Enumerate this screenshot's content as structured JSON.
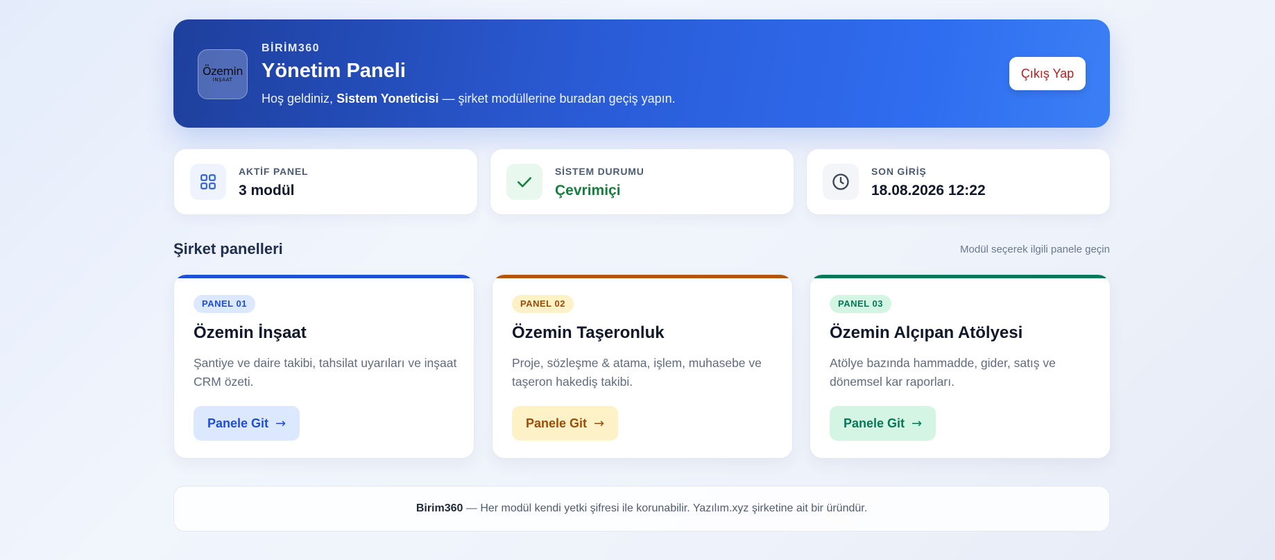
{
  "header": {
    "logo_line1": "Özemin",
    "logo_line2": "İNŞAAT",
    "brand": "BİRİM360",
    "title": "Yönetim Paneli",
    "welcome_prefix": "Hoş geldiniz, ",
    "user_name": "Sistem Yoneticisi",
    "welcome_suffix": " — şirket modüllerine buradan geçiş yapın.",
    "logout_label": "Çıkış Yap"
  },
  "stats": [
    {
      "label": "AKTİF PANEL",
      "value": "3 modül",
      "icon": "grid-icon",
      "value_color": "#0f172a"
    },
    {
      "label": "SİSTEM DURUMU",
      "value": "Çevrimiçi",
      "icon": "check-icon",
      "value_color": "#15803d"
    },
    {
      "label": "SON GİRİŞ",
      "value": "18.08.2026 12:22",
      "icon": "clock-icon",
      "value_color": "#0f172a"
    }
  ],
  "section": {
    "title": "Şirket panelleri",
    "hint": "Modül seçerek ilgili panele geçin"
  },
  "panels": [
    {
      "badge": "PANEL 01",
      "name": "Özemin İnşaat",
      "description": "Şantiye ve daire takibi, tahsilat uyarıları ve inşaat CRM özeti.",
      "button_label": "Panele Git",
      "arrow": "→",
      "accent": "#1d4ed8",
      "badge_bg": "#dbe8fd",
      "button_bg": "#dbe8fd"
    },
    {
      "badge": "PANEL 02",
      "name": "Özemin Taşeronluk",
      "description": "Proje, sözleşme & atama, işlem, muhasebe ve taşeron hakediş takibi.",
      "button_label": "Panele Git",
      "arrow": "→",
      "accent": "#b45309",
      "badge_bg": "#fdf1c7",
      "button_bg": "#fdf1c7"
    },
    {
      "badge": "PANEL 03",
      "name": "Özemin Alçıpan Atölyesi",
      "description": "Atölye bazında hammadde, gider, satış ve dönemsel kar raporları.",
      "button_label": "Panele Git",
      "arrow": "→",
      "accent": "#047857",
      "badge_bg": "#d4f5e4",
      "button_bg": "#d4f5e4"
    }
  ],
  "footer": {
    "brand": "Birim360",
    "text": " — Her modül kendi yetki şifresi ile korunabilir. Yazılım.xyz şirketine ait bir üründür."
  }
}
